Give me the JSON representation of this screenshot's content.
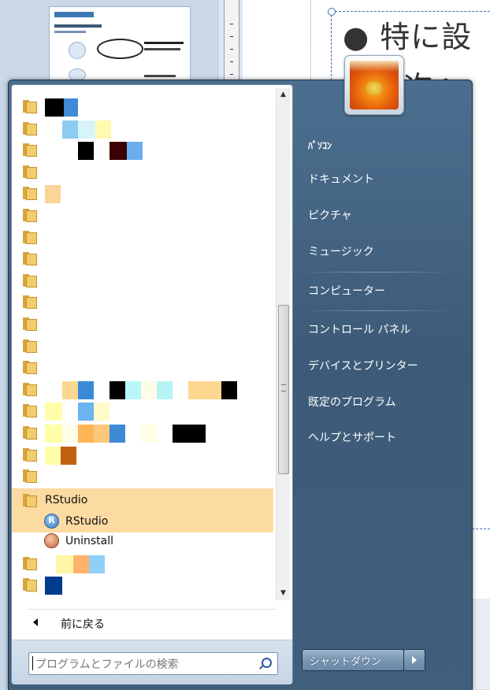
{
  "background": {
    "slide_title_line1": "● 特に設",
    "slide_title_line2": "次へ"
  },
  "start_menu": {
    "programs": [
      {
        "type": "folder",
        "label": "",
        "blocks": [
          [
            "#000000",
            24
          ],
          [
            "#3e8ad6",
            18
          ]
        ]
      },
      {
        "type": "folder",
        "label": "",
        "blocks": [
          [
            "#ffffff",
            22
          ],
          [
            "#8ecbf2",
            20
          ],
          [
            "#d7f4fa",
            22
          ],
          [
            "#fffab0",
            20
          ]
        ]
      },
      {
        "type": "folder",
        "label": "",
        "blocks": [
          [
            "#ffffff",
            42
          ],
          [
            "#000000",
            20
          ],
          [
            "#ffffff",
            20
          ],
          [
            "#3b0000",
            22
          ],
          [
            "#6aaef0",
            20
          ]
        ]
      },
      {
        "type": "folder",
        "label": "",
        "blocks": []
      },
      {
        "type": "folder",
        "label": "",
        "blocks": [
          [
            "#fbd596",
            20
          ]
        ]
      },
      {
        "type": "folder",
        "label": "",
        "blocks": []
      },
      {
        "type": "folder",
        "label": "",
        "blocks": []
      },
      {
        "type": "folder",
        "label": "",
        "blocks": []
      },
      {
        "type": "folder",
        "label": "",
        "blocks": []
      },
      {
        "type": "folder",
        "label": "",
        "blocks": []
      },
      {
        "type": "folder",
        "label": "",
        "blocks": []
      },
      {
        "type": "folder",
        "label": "",
        "blocks": []
      },
      {
        "type": "folder",
        "label": "",
        "blocks": []
      },
      {
        "type": "folder",
        "label": "",
        "blocks": [
          [
            "#ffffff",
            22
          ],
          [
            "#fdd690",
            20
          ],
          [
            "#3a8ad8",
            20
          ],
          [
            "#ffffff",
            20
          ],
          [
            "#000000",
            20
          ],
          [
            "#b8f6f8",
            20
          ],
          [
            "#fefce6",
            20
          ],
          [
            "#b6f3f6",
            20
          ],
          [
            "#ffffff",
            20
          ],
          [
            "#fdd690",
            42
          ],
          [
            "#000000",
            20
          ]
        ]
      },
      {
        "type": "folder",
        "label": "",
        "blocks": [
          [
            "#ffffaa",
            22
          ],
          [
            "#ffffff",
            20
          ],
          [
            "#6ab4f2",
            20
          ],
          [
            "#fffac8",
            20
          ]
        ]
      },
      {
        "type": "folder",
        "label": "",
        "blocks": [
          [
            "#ffffaa",
            22
          ],
          [
            "#fffce8",
            20
          ],
          [
            "#ffb455",
            20
          ],
          [
            "#fdc87a",
            20
          ],
          [
            "#3f8ad6",
            20
          ],
          [
            "#ffffff",
            20
          ],
          [
            "#fffde4",
            20
          ],
          [
            "#ffffff",
            20
          ],
          [
            "#000000",
            42
          ]
        ]
      },
      {
        "type": "folder",
        "label": "",
        "blocks": [
          [
            "#ffffaa",
            20
          ],
          [
            "#c06010",
            20
          ]
        ]
      },
      {
        "type": "folder",
        "label": "",
        "blocks": []
      },
      {
        "type": "folder-open",
        "label": "RStudio",
        "blocks": []
      },
      {
        "type": "app-r",
        "label": "RStudio",
        "blocks": []
      },
      {
        "type": "app-u",
        "label": "Uninstall",
        "blocks": []
      },
      {
        "type": "folder",
        "label": "",
        "blocks": [
          [
            "#ffffff",
            14
          ],
          [
            "#fff6a6",
            22
          ],
          [
            "#ffb26b",
            20
          ],
          [
            "#8fd0f6",
            20
          ]
        ]
      },
      {
        "type": "folder",
        "label": "",
        "blocks": [
          [
            "#003c8c",
            22
          ]
        ]
      }
    ],
    "back_label": "前に戻る",
    "search_placeholder": "プログラムとファイルの検索",
    "right_items": {
      "user": "ﾊﾟｿｺﾝ",
      "documents": "ドキュメント",
      "pictures": "ピクチャ",
      "music": "ミュージック",
      "computer": "コンピューター",
      "control_panel": "コントロール パネル",
      "devices": "デバイスとプリンター",
      "default_programs": "既定のプログラム",
      "help": "ヘルプとサポート"
    },
    "shutdown_label": "シャットダウン"
  }
}
